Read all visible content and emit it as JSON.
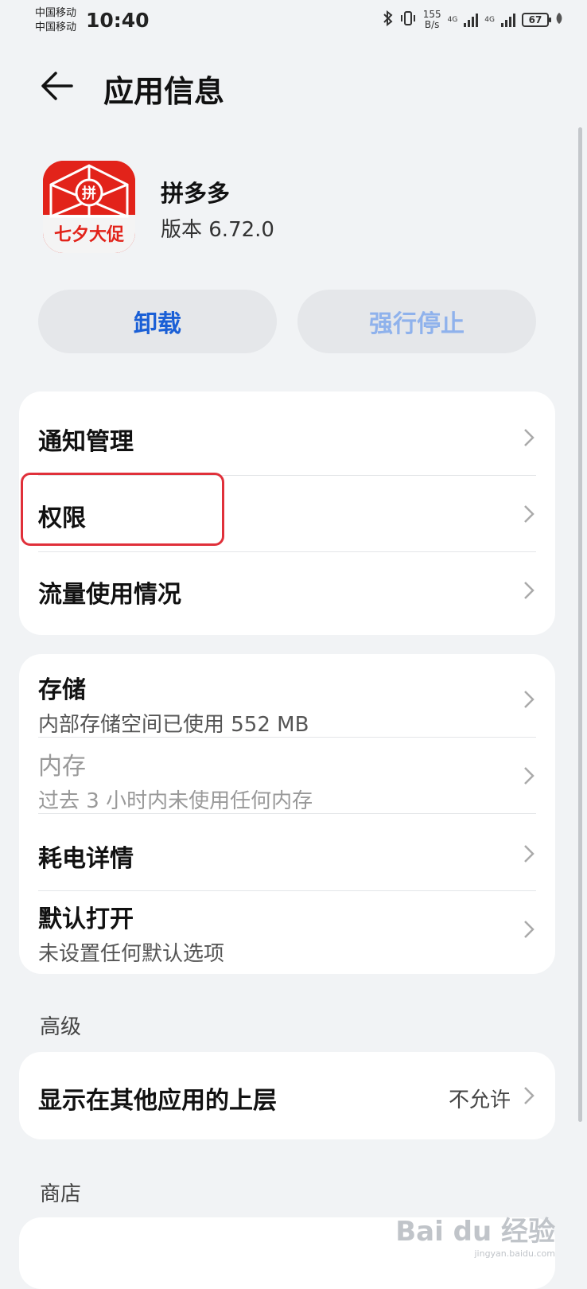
{
  "status_bar": {
    "carrier1": "中国移动",
    "carrier2": "中国移动",
    "time": "10:40",
    "speed_value": "155",
    "speed_unit": "B/s",
    "network_label": "4G",
    "battery": "67"
  },
  "header": {
    "title": "应用信息"
  },
  "app": {
    "name": "拼多多",
    "version": "版本 6.72.0",
    "icon_center_text": "拼",
    "icon_banner_text": "七夕大促"
  },
  "actions": {
    "uninstall": "卸载",
    "force_stop": "强行停止"
  },
  "group1": [
    {
      "label": "通知管理"
    },
    {
      "label": "权限"
    },
    {
      "label": "流量使用情况"
    }
  ],
  "group2": [
    {
      "label": "存储",
      "sub": "内部存储空间已使用 552 MB"
    },
    {
      "label": "内存",
      "sub": "过去 3 小时内未使用任何内存"
    },
    {
      "label": "耗电详情"
    },
    {
      "label": "默认打开",
      "sub": "未设置任何默认选项"
    }
  ],
  "advanced": {
    "header": "高级",
    "overlay_label": "显示在其他应用的上层",
    "overlay_value": "不允许"
  },
  "store": {
    "header": "商店"
  },
  "watermark": {
    "brand": "Bai du 经验",
    "url": "jingyan.baidu.com"
  },
  "colors": {
    "accent": "#1a5fd6",
    "highlight": "#e0303a",
    "app_icon": "#e2231a"
  }
}
